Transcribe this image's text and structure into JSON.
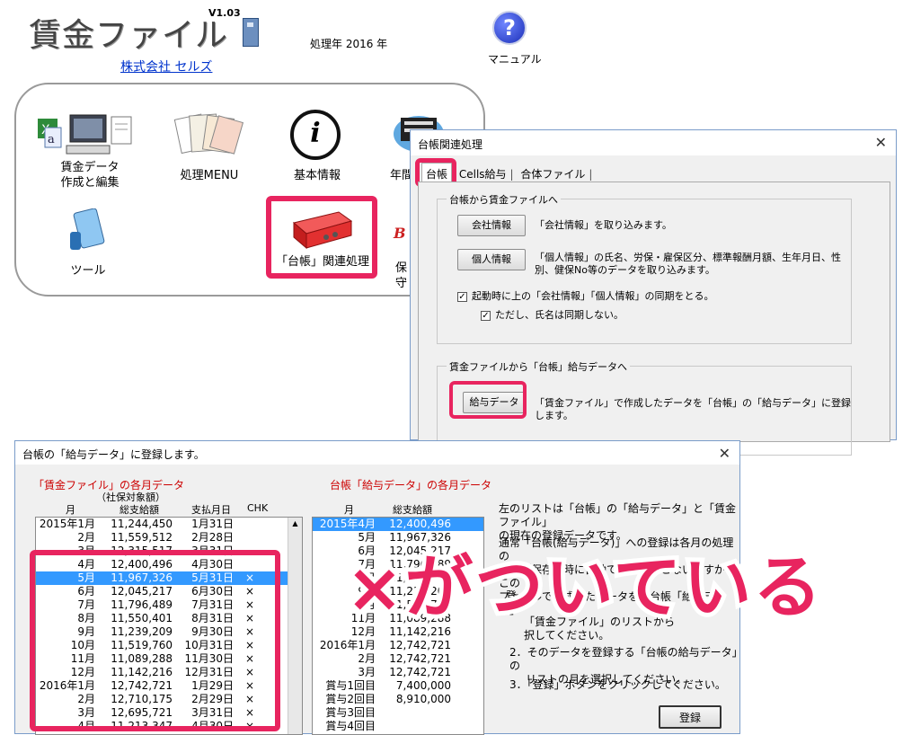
{
  "main": {
    "app_title": "賃金ファイル",
    "version": "V1.03",
    "year_label": "処理年  2016 年",
    "company": "株式会社  セルズ",
    "manual_label": "マニュアル",
    "menu": [
      {
        "label_line1": "賃金データ",
        "label_line2": "作成と編集"
      },
      {
        "label": "処理MENU"
      },
      {
        "label": "基本情報"
      },
      {
        "label": "年間"
      },
      {
        "label": "ツール"
      },
      {
        "label": "「台帳」関連処理"
      },
      {
        "label": "保守"
      }
    ]
  },
  "dialog1": {
    "title": "台帳関連処理",
    "tabs": [
      "台帳",
      "Cells給与",
      "合体ファイル"
    ],
    "group1_title": "台帳から賃金ファイルへ",
    "company_btn": "会社情報",
    "company_desc": "「会社情報」を取り込みます。",
    "person_btn": "個人情報",
    "person_desc_line1": "「個人情報」の氏名、労保・雇保区分、標準報酬月額、生年月日、性",
    "person_desc_line2": "別、健保No等のデータを取り込みます。",
    "sync_check": "起動時に上の「会社情報」「個人情報」の同期をとる。",
    "name_check": "ただし、氏名は同期しない。",
    "group2_title": "賃金ファイルから「台帳」給与データへ",
    "salary_btn": "給与データ",
    "salary_desc": "「賃金ファイル」で作成したデータを「台帳」の「給与データ」に登録します。"
  },
  "dialog2": {
    "title": "台帳の「給与データ」に登録します。",
    "left_heading": "「賃金ファイル」の各月データ",
    "left_subheading": "（社保対象額）",
    "left_cols": [
      "月",
      "総支給額",
      "支払月日",
      "CHK"
    ],
    "left_rows": [
      {
        "month": "2015年1月",
        "amount": "11,244,450",
        "paydate": "1月31日",
        "chk": ""
      },
      {
        "month": "2月",
        "amount": "11,559,512",
        "paydate": "2月28日",
        "chk": ""
      },
      {
        "month": "3月",
        "amount": "12,315,517",
        "paydate": "3月31日",
        "chk": ""
      },
      {
        "month": "4月",
        "amount": "12,400,496",
        "paydate": "4月30日",
        "chk": ""
      },
      {
        "month": "5月",
        "amount": "11,967,326",
        "paydate": "5月31日",
        "chk": "×"
      },
      {
        "month": "6月",
        "amount": "12,045,217",
        "paydate": "6月30日",
        "chk": "×"
      },
      {
        "month": "7月",
        "amount": "11,796,489",
        "paydate": "7月31日",
        "chk": "×"
      },
      {
        "month": "8月",
        "amount": "11,550,401",
        "paydate": "8月31日",
        "chk": "×"
      },
      {
        "month": "9月",
        "amount": "11,239,209",
        "paydate": "9月30日",
        "chk": "×"
      },
      {
        "month": "10月",
        "amount": "11,519,760",
        "paydate": "10月31日",
        "chk": "×"
      },
      {
        "month": "11月",
        "amount": "11,089,288",
        "paydate": "11月30日",
        "chk": "×"
      },
      {
        "month": "12月",
        "amount": "11,142,216",
        "paydate": "12月31日",
        "chk": "×"
      },
      {
        "month": "2016年1月",
        "amount": "12,742,721",
        "paydate": "1月29日",
        "chk": "×"
      },
      {
        "month": "2月",
        "amount": "12,710,175",
        "paydate": "2月29日",
        "chk": "×"
      },
      {
        "month": "3月",
        "amount": "12,695,721",
        "paydate": "3月31日",
        "chk": "×"
      },
      {
        "month": "4月",
        "amount": "11,213,347",
        "paydate": "4月30日",
        "chk": "×"
      }
    ],
    "right_heading": "台帳「給与データ」の各月データ",
    "right_cols": [
      "月",
      "総支給額"
    ],
    "right_rows": [
      {
        "month": "2015年4月",
        "amount": "12,400,496"
      },
      {
        "month": "5月",
        "amount": "11,967,326"
      },
      {
        "month": "6月",
        "amount": "12,045,217"
      },
      {
        "month": "7月",
        "amount": "11,796,489"
      },
      {
        "month": "8月",
        "amount": "11,550,401"
      },
      {
        "month": "9月",
        "amount": "11,239,209"
      },
      {
        "month": "10月",
        "amount": "11,519,760"
      },
      {
        "month": "11月",
        "amount": "11,089,288"
      },
      {
        "month": "12月",
        "amount": "11,142,216"
      },
      {
        "month": "2016年1月",
        "amount": "12,742,721"
      },
      {
        "month": "2月",
        "amount": "12,742,721"
      },
      {
        "month": "3月",
        "amount": "12,742,721"
      },
      {
        "month": "賞与1回目",
        "amount": "7,400,000"
      },
      {
        "month": "賞与2回目",
        "amount": "8,910,000"
      },
      {
        "month": "賞与3回目",
        "amount": ""
      },
      {
        "month": "賞与4回目",
        "amount": ""
      }
    ],
    "info_line1": "左のリストは「台帳」の「給与データ」と「賃金ファイル」",
    "info_line2": "の現在の登録データです。",
    "info_line3": "通常「台帳(給与データ)」への登録は各月の処理の",
    "info_line4": "際の「保存」時に自動で登録をおこないますが、この",
    "info_line5": "ファイルで作成したデータを、台帳「給与データ」",
    "step1_mark": "登",
    "step1_line1": "「賃金ファイル」のリストから",
    "step1_line2": "択してください。",
    "step2_line1": "2．そのデータを登録する「台帳の給与データ」の",
    "step2_line2": "リストの月を選択してください。",
    "step3": "3．「登録」ボタンをクリックしてください。",
    "register_btn": "登録"
  },
  "overlay": {
    "caption": "×がついている"
  },
  "colors": {
    "highlight": "#e8245f",
    "selection": "#3399ff",
    "red_heading": "#cc0000",
    "link": "#0033cc"
  }
}
